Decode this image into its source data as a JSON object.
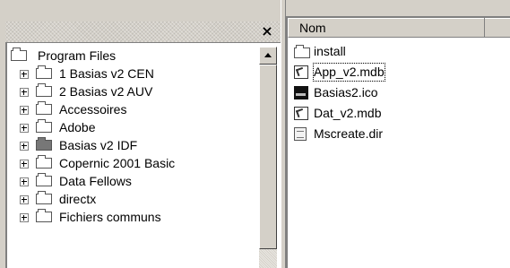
{
  "tree_pane": {
    "close_glyph": "×",
    "items": [
      {
        "label": "Program Files",
        "icon": "folder-open-icon"
      },
      {
        "label": "1 Basias v2 CEN",
        "icon": "folder-icon"
      },
      {
        "label": "2 Basias v2 AUV",
        "icon": "folder-icon"
      },
      {
        "label": "Accessoires",
        "icon": "folder-icon"
      },
      {
        "label": "Adobe",
        "icon": "folder-icon"
      },
      {
        "label": "Basias v2 IDF",
        "icon": "shared-folder-icon"
      },
      {
        "label": "Copernic 2001 Basic",
        "icon": "folder-icon"
      },
      {
        "label": "Data Fellows",
        "icon": "folder-icon"
      },
      {
        "label": "directx",
        "icon": "folder-icon"
      },
      {
        "label": "Fichiers communs",
        "icon": "folder-icon"
      }
    ]
  },
  "list_pane": {
    "column_name": "Nom",
    "files": [
      {
        "name": "install",
        "icon": "folder-icon"
      },
      {
        "name": "App_v2.mdb",
        "icon": "access-db-icon"
      },
      {
        "name": "Basias2.ico",
        "icon": "image-icon"
      },
      {
        "name": "Dat_v2.mdb",
        "icon": "access-db-icon"
      },
      {
        "name": "Mscreate.dir",
        "icon": "system-file-icon"
      }
    ]
  }
}
